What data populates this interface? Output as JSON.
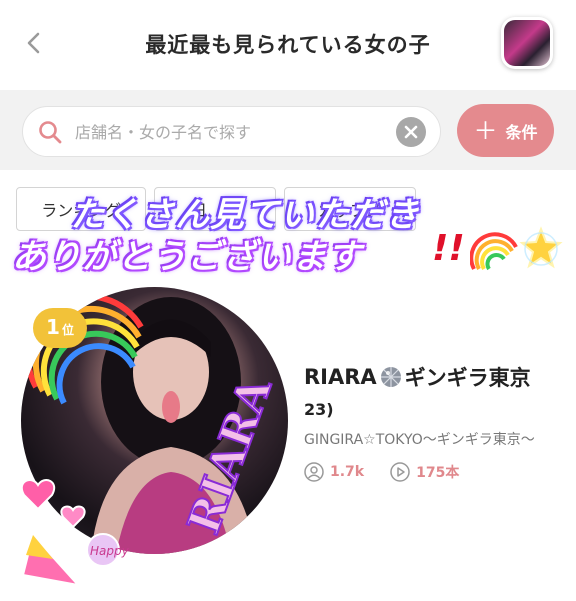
{
  "header": {
    "title": "最近最も見られている女の子"
  },
  "search": {
    "placeholder": "店舗名・女の子名で探す",
    "filter_label": "条件"
  },
  "chips": [
    {
      "label": "ランキング"
    },
    {
      "label": "日　数"
    },
    {
      "label": "カップメ"
    }
  ],
  "banner": {
    "line1": "たくさん見ていただき",
    "line2": "ありがとうございます",
    "exclamation": "!!"
  },
  "ranking": {
    "rank_number": "1",
    "rank_unit": "位",
    "name_part1": "RIARA",
    "name_part2": "ギンギラ東京",
    "age": "23)",
    "shop": "GINGIRA☆TOKYO〜ギンギラ東京〜",
    "views": "1.7k",
    "videos": "175本",
    "photo_watermark": "RIARA",
    "sticker_text": "Happy"
  },
  "colors": {
    "accent": "#e48a8e",
    "badge_gold": "#f2c239",
    "banner_glow": "#8a5cff"
  },
  "icons": {
    "back": "chevron-left-icon",
    "search": "search-icon",
    "clear": "clear-icon",
    "plus": "plus-icon",
    "views": "person-icon",
    "videos": "play-icon"
  }
}
